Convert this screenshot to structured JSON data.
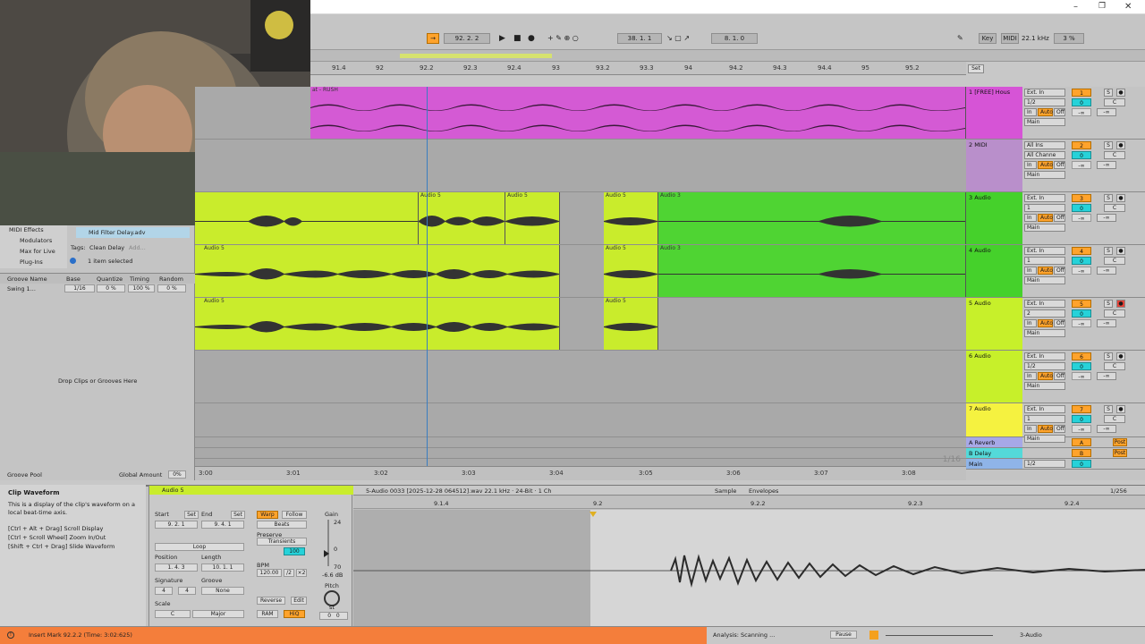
{
  "transport": {
    "position": "92.  2.  2",
    "loop_start": "38.  1.  1",
    "loop_length": "8.  1.  0",
    "key_label": "Key",
    "midi_label": "MIDI",
    "sample_rate": "22.1 kHz",
    "cpu": "3 %"
  },
  "ruler": {
    "bars": [
      "91.4",
      "92",
      "92.2",
      "92.3",
      "92.4",
      "93",
      "93.2",
      "93.3",
      "94",
      "94.2",
      "94.3",
      "94.4",
      "95",
      "95.2"
    ],
    "set_label": "Set"
  },
  "timeline": {
    "times": [
      "3:00",
      "3:01",
      "3:02",
      "3:03",
      "3:04",
      "3:05",
      "3:06",
      "3:07",
      "3:08"
    ],
    "zoom": "1/16"
  },
  "tracks": [
    {
      "name": "1 [FREE] Hous",
      "input": "Ext. In",
      "channel": "1/2",
      "number": "1",
      "vol": "0",
      "pan": "C",
      "out": "Main",
      "color": "#d654d6"
    },
    {
      "name": "2 MIDI",
      "input": "All Ins",
      "channel": "All Channe",
      "number": "2",
      "vol": "0",
      "pan": "C",
      "out": "Main",
      "color": "#b98fcb"
    },
    {
      "name": "3 Audio",
      "input": "Ext. In",
      "channel": "1",
      "number": "3",
      "vol": "0",
      "pan": "C",
      "out": "Main",
      "color": "#45d12b"
    },
    {
      "name": "4 Audio",
      "input": "Ext. In",
      "channel": "1",
      "number": "4",
      "vol": "0",
      "pan": "C",
      "out": "Main",
      "color": "#45d12b"
    },
    {
      "name": "5 Audio",
      "input": "Ext. In",
      "channel": "2",
      "number": "5",
      "vol": "0",
      "pan": "C",
      "out": "Main",
      "color": "#c7f02a"
    },
    {
      "name": "6 Audio",
      "input": "Ext. In",
      "channel": "1/2",
      "number": "6",
      "vol": "0",
      "pan": "C",
      "out": "Main",
      "color": "#c7f02a"
    },
    {
      "name": "7 Audio",
      "input": "Ext. In",
      "channel": "1",
      "number": "7",
      "vol": "0",
      "pan": "C",
      "out": "Main",
      "color": "#f5f240"
    }
  ],
  "io_labels": {
    "in": "In",
    "auto": "Auto",
    "off": "Off",
    "minus_inf": "-∞"
  },
  "returns": [
    {
      "name": "A Reverb",
      "letter": "A",
      "post": "Post"
    },
    {
      "name": "B Delay",
      "letter": "B",
      "post": "Post"
    }
  ],
  "master": {
    "name": "Main",
    "channel": "1/2",
    "vol": "0"
  },
  "clips": {
    "track1_label": "at - RUSH",
    "audio5": "Audio 5",
    "audio3": "Audio 3"
  },
  "browser": {
    "items": [
      "MIDI Effects",
      "Modulators",
      "Max for Live",
      "Plug-Ins"
    ],
    "file": "Mid Filter Delay.adv",
    "tags_label": "Tags:",
    "tag": "Clean Delay",
    "add": "Add...",
    "selected": "1 item selected"
  },
  "groove": {
    "headers": [
      "Groove Name",
      "Base",
      "Quantize",
      "Timing",
      "Random"
    ],
    "row": {
      "name": "Swing 1...",
      "base": "1/16",
      "quantize": "0 %",
      "timing": "100 %",
      "random": "0 %"
    },
    "drop_text": "Drop Clips or Grooves Here",
    "pool": "Groove Pool",
    "global_label": "Global Amount",
    "global_value": "0%"
  },
  "info": {
    "title": "Clip Waveform",
    "body": "This is a display of the clip's waveform on a local beat-time axis.",
    "hints": [
      "[Ctrl + Alt + Drag] Scroll Display",
      "[Ctrl + Scroll Wheel] Zoom In/Out",
      "[Shift + Ctrl + Drag] Slide Waveform"
    ]
  },
  "clip": {
    "name": "Audio 5",
    "start_label": "Start",
    "end_label": "End",
    "set": "Set",
    "start": "9.  2.  1",
    "end": "9.  4.  1",
    "loop": "Loop",
    "position_label": "Position",
    "length_label": "Length",
    "position": "1.  4.  3",
    "length": "10.  1.  1",
    "signature_label": "Signature",
    "groove_label": "Groove",
    "sig_num": "4",
    "sig_den": "4",
    "groove_value": "None",
    "scale_label": "Scale",
    "scale_root": "C",
    "scale_mode": "Major",
    "warp": "Warp",
    "follow": "Follow",
    "beats": "Beats",
    "preserve_label": "Preserve",
    "preserve": "Transients",
    "transient_value": "100",
    "bpm_label": "BPM",
    "bpm": "120.00",
    "half": "/2",
    "double": "×2",
    "reverse": "Reverse",
    "edit": "Edit",
    "ram": "RAM",
    "hiq": "HiQ",
    "gain_label": "Gain",
    "gain_top": "24",
    "gain_zero": "0",
    "gain_bottom": "70",
    "gain_value": "-6.6 dB",
    "pitch_label": "Pitch",
    "pitch_unit": "st",
    "pitch_value": "0",
    "pitch_fine": "0"
  },
  "sample": {
    "file": "5-Audio 0033 [2025-12-28 064512].wav  22.1 kHz · 24-Bit · 1 Ch",
    "tab_sample": "Sample",
    "tab_envelopes": "Envelopes",
    "zoom": "1/256",
    "ruler": [
      "9.1.4",
      "9.2",
      "9.2.2",
      "9.2.3",
      "9.2.4"
    ]
  },
  "status": {
    "message": "Insert Mark 92.2.2 (Time: 3:02:625)",
    "analysis": "Analysis: Scanning ...",
    "pause": "Pause",
    "track": "3-Audio"
  }
}
